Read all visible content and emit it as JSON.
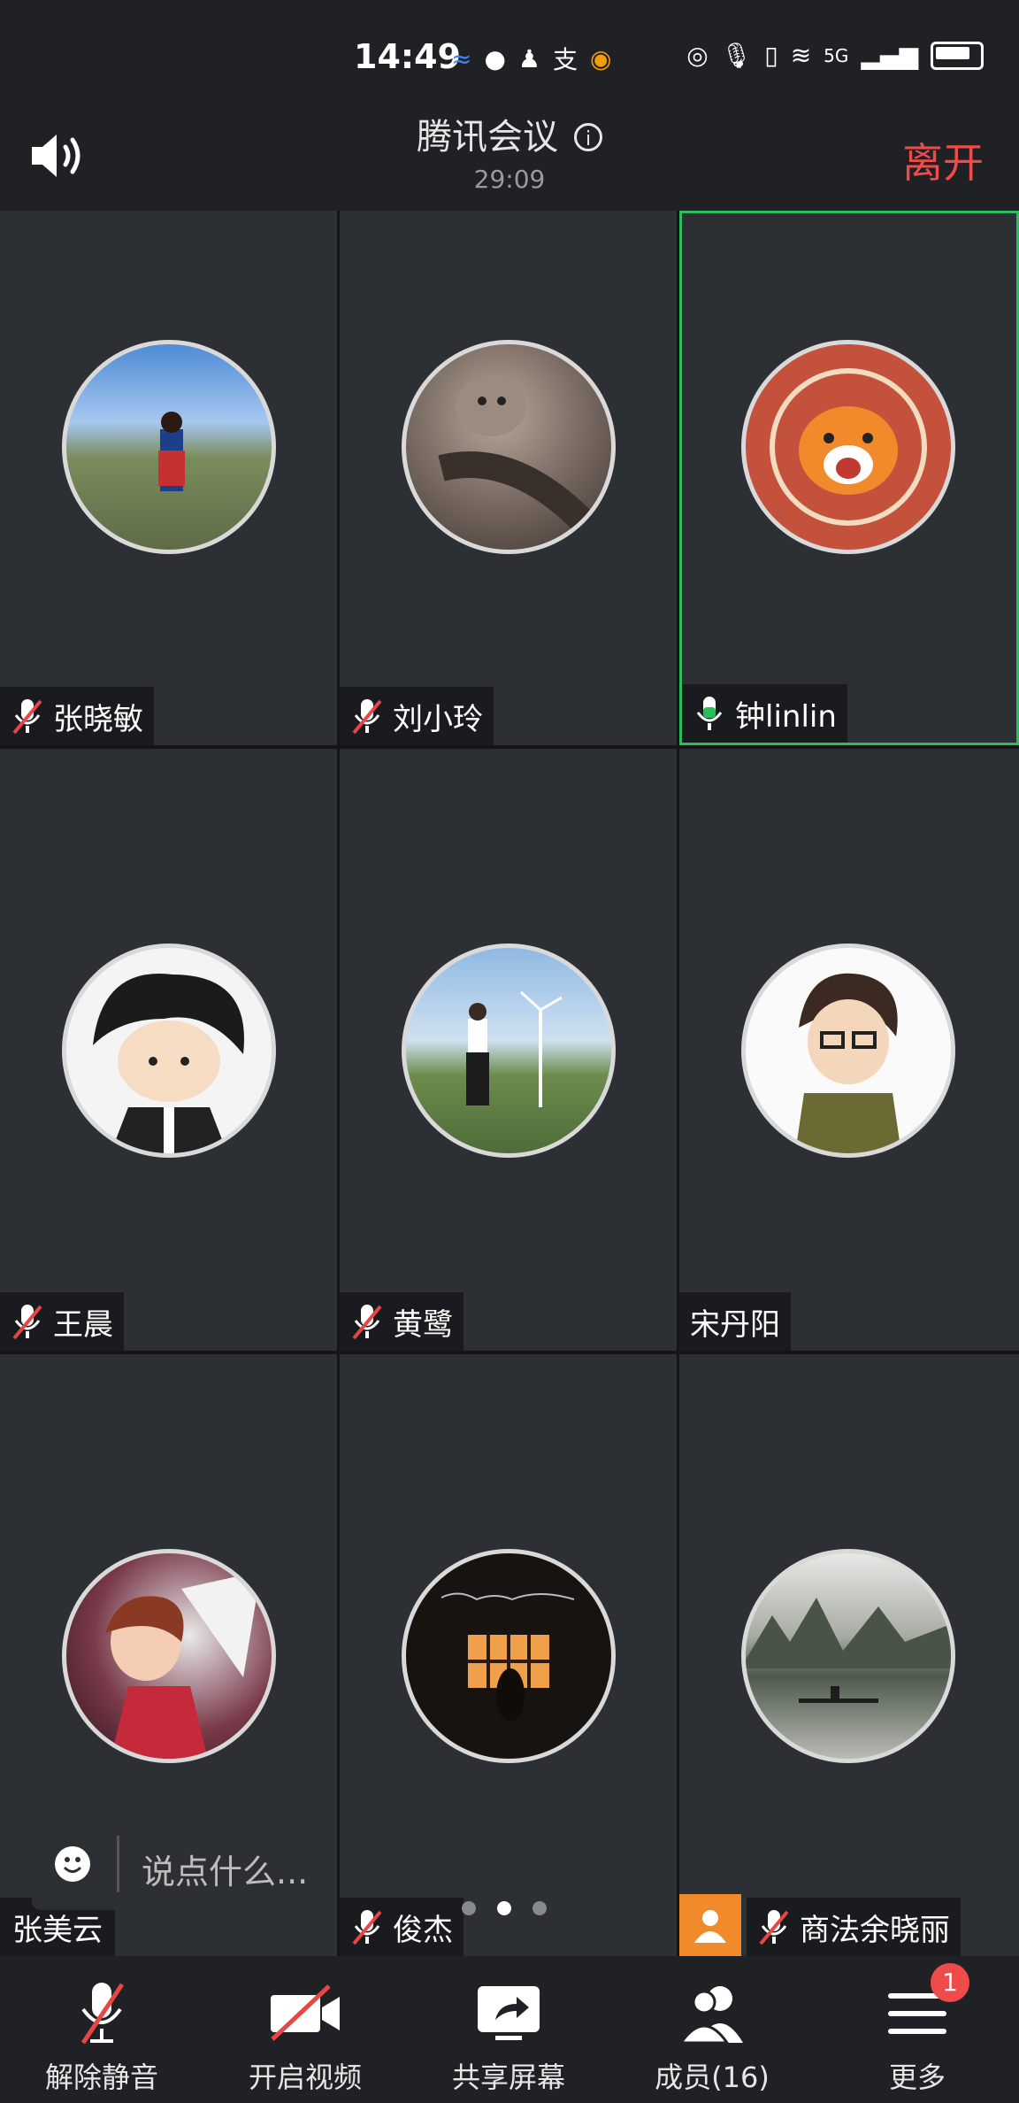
{
  "status_bar": {
    "time": "14:49",
    "left_icons": [
      "mosaic-app-icon",
      "wechat-icon",
      "qq-icon",
      "alipay-icon",
      "colorful-app-icon"
    ],
    "right_icons": [
      "eye-icon",
      "mic-icon",
      "vibrate-icon",
      "wifi-icon",
      "5g-signal-icon",
      "battery-icon"
    ],
    "network": "5G"
  },
  "header": {
    "title": "腾讯会议",
    "duration": "29:09",
    "leave_label": "离开"
  },
  "participants": [
    {
      "name": "张晓敏",
      "mic": "muted",
      "avatar": "landscape-woman-photo"
    },
    {
      "name": "刘小玲",
      "mic": "muted",
      "avatar": "cat-photo"
    },
    {
      "name": "钟linlin",
      "mic": "speaking",
      "avatar": "tiger-illustration"
    },
    {
      "name": "王晨",
      "mic": "muted",
      "avatar": "cartoon-boy"
    },
    {
      "name": "黄鹭",
      "mic": "muted",
      "avatar": "wind-turbine-photo"
    },
    {
      "name": "宋丹阳",
      "mic": "none",
      "avatar": "cartoon-man-glasses"
    },
    {
      "name": "张美云",
      "mic": "none",
      "avatar": "anime-girl-wings"
    },
    {
      "name": "俊杰",
      "mic": "muted",
      "avatar": "dark-window-photo"
    },
    {
      "name": "商法余晓丽",
      "mic": "muted",
      "avatar": "karst-river-photo",
      "host": true
    }
  ],
  "chat": {
    "placeholder": "说点什么..."
  },
  "pager": {
    "pages": 3,
    "current": 2
  },
  "toolbar": {
    "unmute": "解除静音",
    "video": "开启视频",
    "share": "共享屏幕",
    "members": "成员(16)",
    "more": "更多",
    "more_badge": "1"
  },
  "colors": {
    "background": "#1f2124",
    "tile": "#2c2f33",
    "speaking_border": "#2dbb5c",
    "leave": "#f04b4b",
    "mute_red": "#e84545",
    "host_badge": "#f08a2a"
  }
}
